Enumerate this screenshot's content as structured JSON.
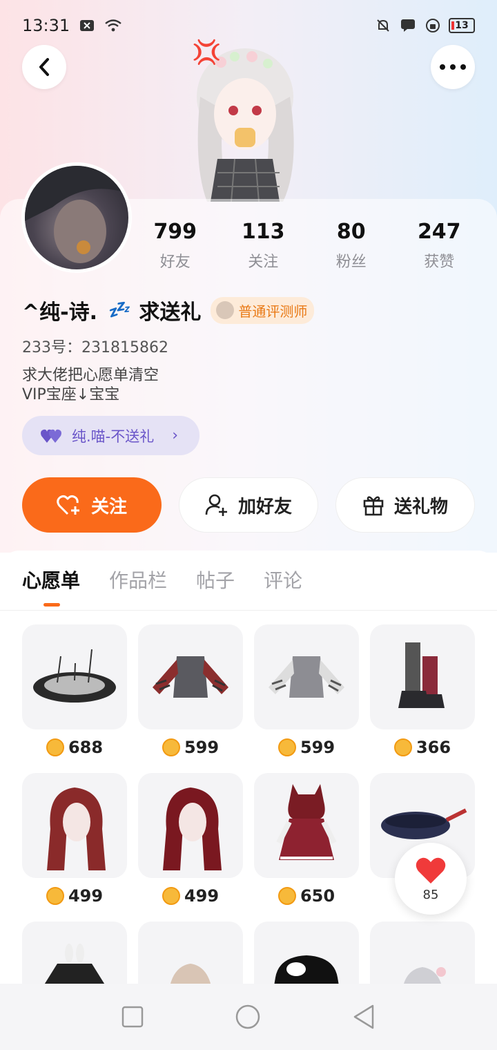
{
  "status_bar": {
    "time": "13:31",
    "battery": "13"
  },
  "profile": {
    "stats": [
      {
        "value": "799",
        "label": "好友"
      },
      {
        "value": "113",
        "label": "关注"
      },
      {
        "value": "80",
        "label": "粉丝"
      },
      {
        "value": "247",
        "label": "获赞"
      }
    ],
    "name": "^纯-诗.",
    "status_emoji": "💤",
    "tagline": "求送礼",
    "badge": "普通评测师",
    "uid": "233号：231815862",
    "bio_line1": "求大佬把心愿单清空",
    "bio_line2": "VIP宝座↓宝宝",
    "fan_pill": "纯.喵-不送礼"
  },
  "actions": {
    "follow": "关注",
    "add_friend": "加好友",
    "send_gift": "送礼物"
  },
  "tabs": [
    "心愿单",
    "作品栏",
    "帖子",
    "评论"
  ],
  "wishlist": [
    {
      "price": "688",
      "kind": "floor-effect"
    },
    {
      "price": "599",
      "kind": "striped-sweater-red"
    },
    {
      "price": "599",
      "kind": "striped-sweater-white"
    },
    {
      "price": "366",
      "kind": "boots"
    },
    {
      "price": "499",
      "kind": "red-hair"
    },
    {
      "price": "499",
      "kind": "dark-red-hair"
    },
    {
      "price": "650",
      "kind": "red-hood-dress"
    },
    {
      "price": "",
      "kind": "wok"
    },
    {
      "price": "",
      "kind": "black-bunny-outfit"
    },
    {
      "price": "",
      "kind": "blonde-hair"
    },
    {
      "price": "",
      "kind": "black-hat"
    },
    {
      "price": "",
      "kind": "silver-hair"
    }
  ],
  "like_float": {
    "count": "85"
  },
  "colors": {
    "accent": "#fa6a1a",
    "pill": "#6a55c9"
  }
}
